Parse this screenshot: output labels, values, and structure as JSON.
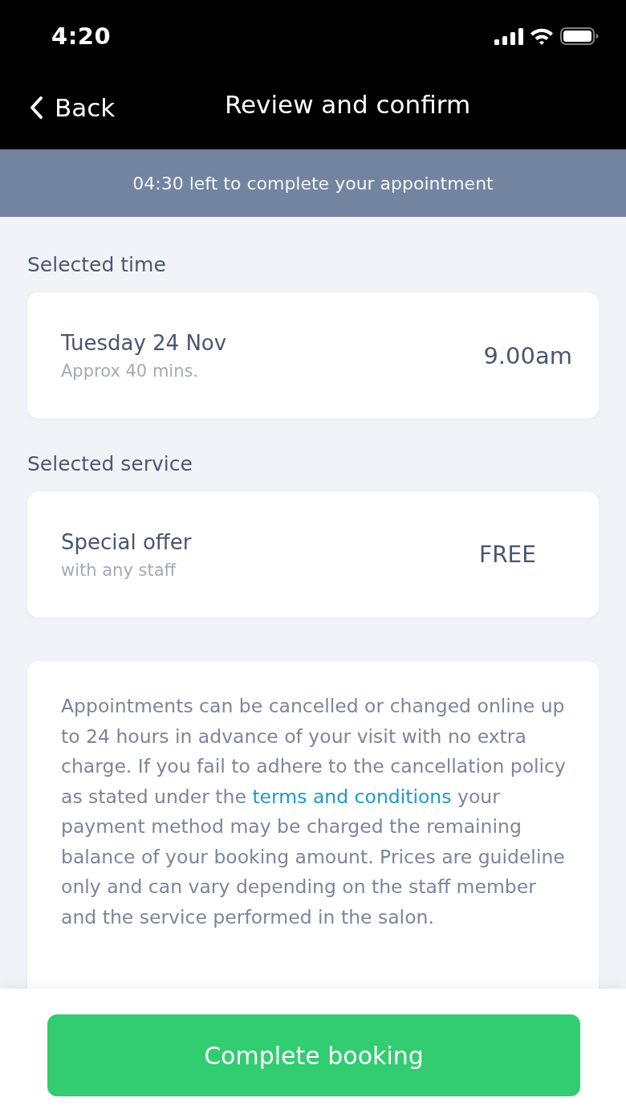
{
  "status_bar": {
    "time": "4:20"
  },
  "nav_bar": {
    "back": "Back",
    "title": "Review and confirm"
  },
  "timer_banner": {
    "text": "04:30 left to complete your appointment"
  },
  "sections": [
    {
      "heading": "Selected time",
      "card": {
        "kind": "time",
        "title": "Tuesday 24 Nov",
        "subtitle": "Approx 40 mins.",
        "value": "9.00am"
      }
    },
    {
      "heading": "Selected service",
      "card": {
        "kind": "price",
        "title": "Special offer",
        "subtitle": "with any staff",
        "value": "FREE"
      }
    }
  ],
  "policy": {
    "text_before": "Appointments can be cancelled or changed online up to 24 hours in advance of your visit with no extra charge. If you fail to adhere to the cancellation policy as stated under the",
    "link": "terms and conditions",
    "text_after": "your payment method may be charged the remaining balance of your booking amount. Prices are guideline only and can vary depending on the staff member and the service performed in the salon."
  },
  "footer": {
    "button": "Complete booking"
  }
}
